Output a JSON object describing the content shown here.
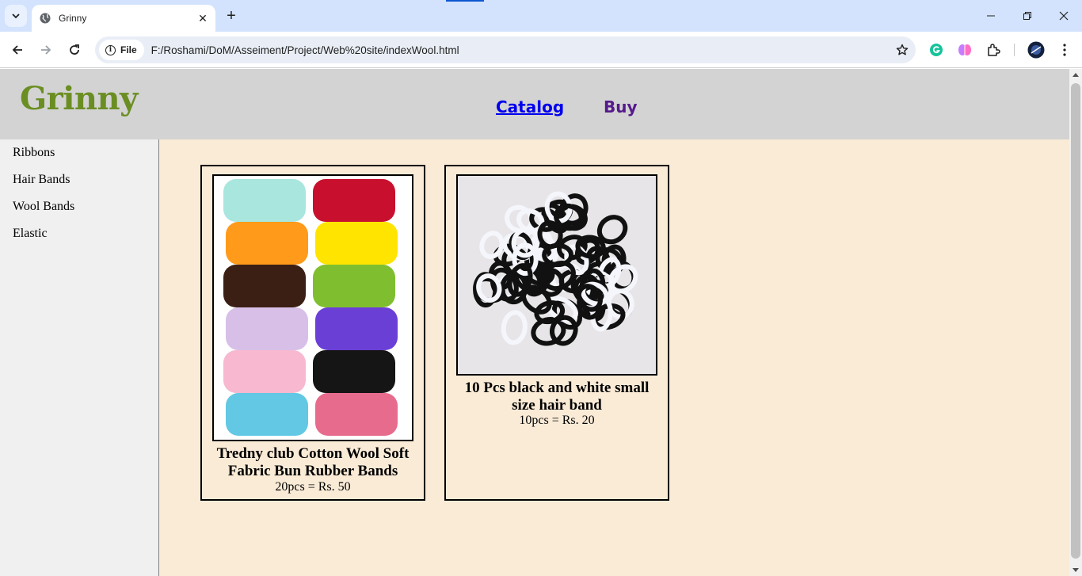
{
  "browser": {
    "tab_title": "Grinny",
    "chip_label": "File",
    "url": "F:/Roshami/DoM/Asseiment/Project/Web%20site/indexWool.html"
  },
  "site": {
    "logo": "Grinny",
    "nav": [
      {
        "label": "Catalog"
      },
      {
        "label": "Buy"
      }
    ],
    "sidebar": [
      {
        "label": "Ribbons"
      },
      {
        "label": "Hair Bands"
      },
      {
        "label": "Wool Bands"
      },
      {
        "label": "Elastic"
      }
    ],
    "products": [
      {
        "name": "Tredny club Cotton Wool Soft Fabric Bun Rubber Bands",
        "price": "20pcs = Rs. 50",
        "image_colors": [
          "#a8e6de",
          "#c8102e",
          "#ff9a1a",
          "#ffe400",
          "#3b1f14",
          "#7fbf2f",
          "#d7bfe8",
          "#6a3fd6",
          "#f7b8d0",
          "#151515",
          "#62c8e3",
          "#e76b8d"
        ]
      },
      {
        "name": "10 Pcs black and white small size hair band",
        "price": "10pcs = Rs. 20"
      }
    ]
  },
  "colors": {
    "page_bg": "#faebd7",
    "header_bg": "#d3d3d3",
    "logo": "#6b8e23",
    "link": "#0000ee",
    "visited_link": "#551a8b"
  }
}
